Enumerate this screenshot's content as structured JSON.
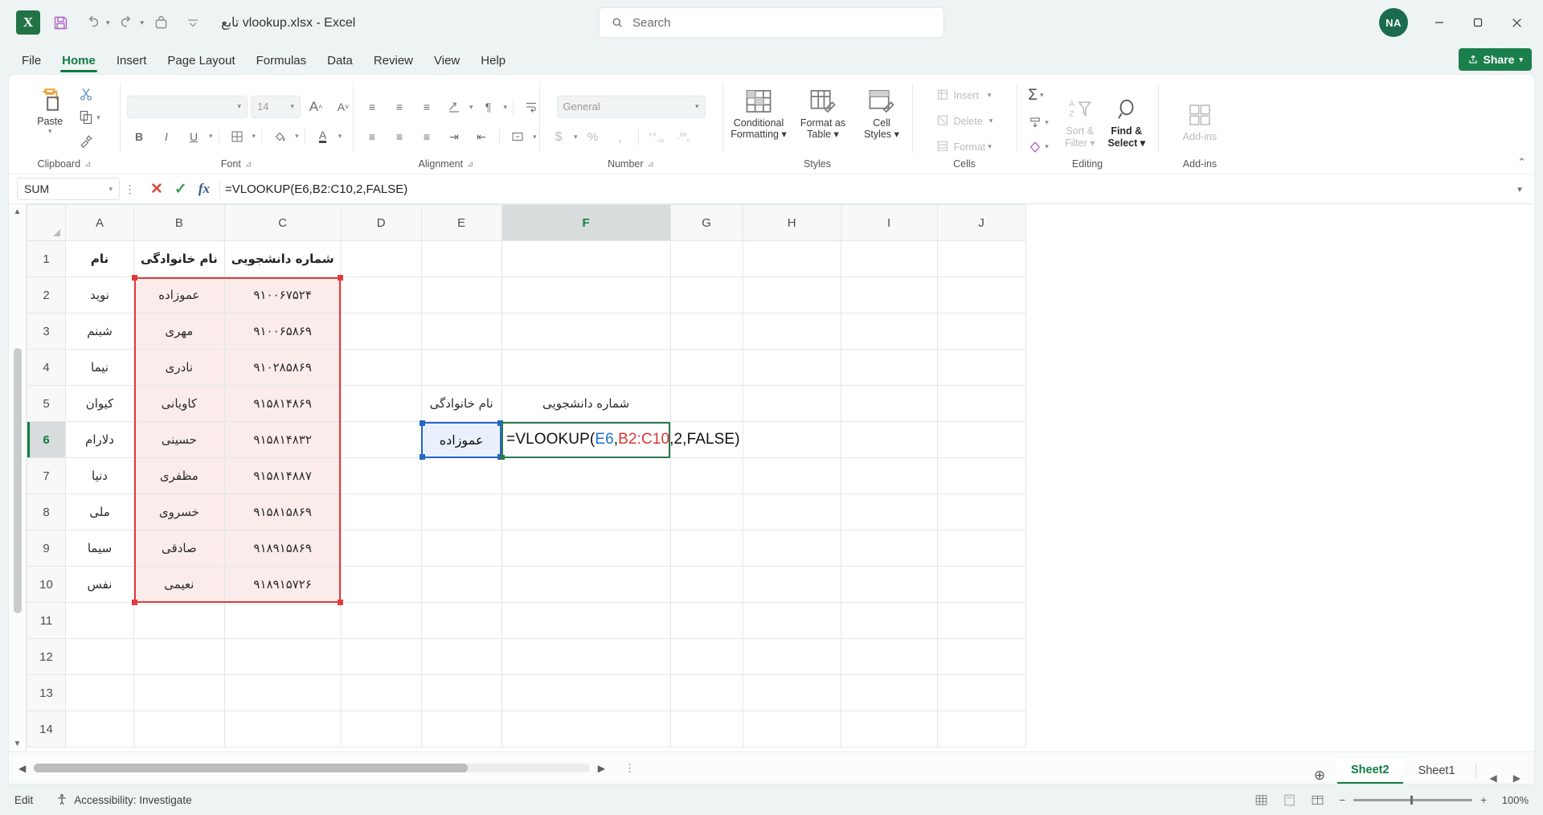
{
  "titlebar": {
    "doc_title": "تابع vlookup.xlsx - Excel",
    "search_placeholder": "Search",
    "avatar_initials": "NA",
    "qat": [
      "save-icon",
      "undo-icon",
      "redo-icon",
      "touch-mode-icon",
      "customize-qat-icon"
    ]
  },
  "tabs": [
    {
      "label": "File",
      "active": false
    },
    {
      "label": "Home",
      "active": true
    },
    {
      "label": "Insert",
      "active": false
    },
    {
      "label": "Page Layout",
      "active": false
    },
    {
      "label": "Formulas",
      "active": false
    },
    {
      "label": "Data",
      "active": false
    },
    {
      "label": "Review",
      "active": false
    },
    {
      "label": "View",
      "active": false
    },
    {
      "label": "Help",
      "active": false
    }
  ],
  "share_label": "Share",
  "ribbon": {
    "groups": [
      "Clipboard",
      "Font",
      "Alignment",
      "Number",
      "Styles",
      "Cells",
      "Editing",
      "Add-ins"
    ],
    "clipboard": {
      "paste_label": "Paste",
      "cut": "cut-icon",
      "copy": "copy-icon",
      "format_painter": "format-painter-icon"
    },
    "font": {
      "font_name": "",
      "font_size": "14",
      "bold": "B",
      "italic": "I",
      "underline": "U"
    },
    "number": {
      "format": "General",
      "currency": "$",
      "percent": "%",
      "comma": ","
    },
    "styles": [
      {
        "label_line1": "Conditional",
        "label_line2": "Formatting"
      },
      {
        "label_line1": "Format as",
        "label_line2": "Table"
      },
      {
        "label_line1": "Cell",
        "label_line2": "Styles"
      }
    ],
    "cells": [
      {
        "label": "Insert",
        "disabled": true
      },
      {
        "label": "Delete",
        "disabled": true
      },
      {
        "label": "Format",
        "disabled": true
      }
    ],
    "editing": [
      {
        "label_line1": "Sort &",
        "label_line2": "Filter",
        "disabled": true
      },
      {
        "label_line1": "Find &",
        "label_line2": "Select",
        "disabled": false
      }
    ],
    "addins": {
      "label": "Add-ins"
    }
  },
  "formula_bar": {
    "name_box": "SUM",
    "cancel": "cancel-icon",
    "enter": "enter-icon",
    "insert_function": "fx",
    "formula": "=VLOOKUP(E6,B2:C10,2,FALSE)"
  },
  "grid": {
    "columns": [
      "J",
      "I",
      "H",
      "G",
      "F",
      "E",
      "D",
      "C",
      "B",
      "A"
    ],
    "selected_column": "F",
    "rows": [
      "1",
      "2",
      "3",
      "4",
      "5",
      "6",
      "7",
      "8",
      "9",
      "10",
      "11",
      "12",
      "13",
      "14"
    ],
    "selected_row": "6",
    "table_headers": {
      "A": "نام",
      "B": "نام خانوادگی",
      "C": "شماره دانشجویی"
    },
    "records": [
      {
        "row": "2",
        "name": "نوید",
        "family": "عموزاده",
        "student_id": "۹۱۰۰۶۷۵۲۴"
      },
      {
        "row": "3",
        "name": "شبنم",
        "family": "مهری",
        "student_id": "۹۱۰۰۶۵۸۶۹"
      },
      {
        "row": "4",
        "name": "نیما",
        "family": "نادری",
        "student_id": "۹۱۰۲۸۵۸۶۹"
      },
      {
        "row": "5",
        "name": "کیوان",
        "family": "کاویانی",
        "student_id": "۹۱۵۸۱۴۸۶۹"
      },
      {
        "row": "6",
        "name": "دلارام",
        "family": "حسینی",
        "student_id": "۹۱۵۸۱۴۸۳۲"
      },
      {
        "row": "7",
        "name": "دنیا",
        "family": "مظفری",
        "student_id": "۹۱۵۸۱۴۸۸۷"
      },
      {
        "row": "8",
        "name": "ملی",
        "family": "خسروی",
        "student_id": "۹۱۵۸۱۵۸۶۹"
      },
      {
        "row": "9",
        "name": "سیما",
        "family": "صادقی",
        "student_id": "۹۱۸۹۱۵۸۶۹"
      },
      {
        "row": "10",
        "name": "نفس",
        "family": "نعیمی",
        "student_id": "۹۱۸۹۱۵۷۲۶"
      }
    ],
    "lookup_area": {
      "label_E5": "نام خانوادگی",
      "label_F5": "شماره دانشجویی",
      "value_E6": "عموزاده",
      "editing_cell": "F6",
      "formula_prefix": "=VLOOKUP(",
      "formula_ref1": "E6",
      "formula_sep1": ",",
      "formula_ref2": "B2:C10",
      "formula_suffix": ",2,FALSE)"
    },
    "range_highlight_color": "#e03b3b"
  },
  "sheet_tabs": {
    "add_label": "+",
    "tabs": [
      {
        "label": "Sheet2",
        "active": true
      },
      {
        "label": "Sheet1",
        "active": false
      }
    ]
  },
  "status_bar": {
    "mode": "Edit",
    "accessibility": "Accessibility: Investigate",
    "zoom": "100%"
  }
}
